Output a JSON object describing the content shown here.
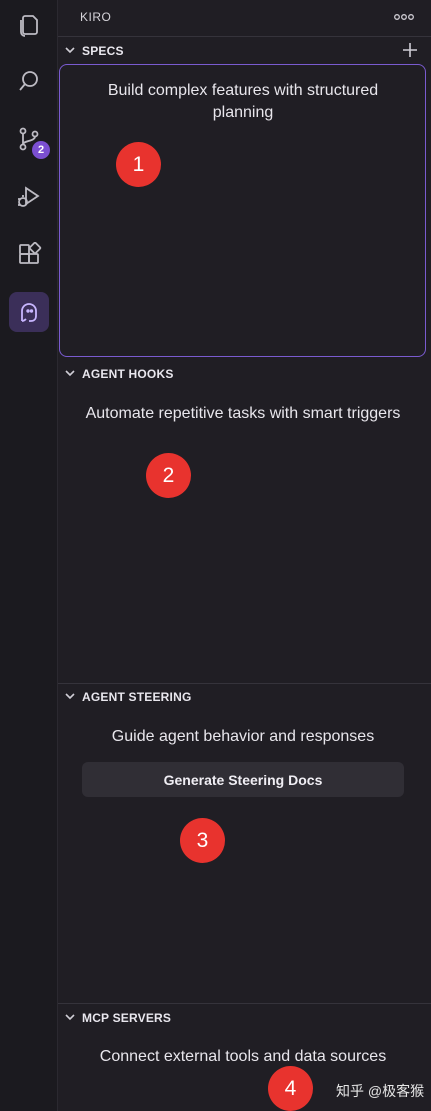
{
  "activity_bar": {
    "scm_badge": "2"
  },
  "panel": {
    "title": "KIRO"
  },
  "sections": {
    "specs": {
      "title": "SPECS",
      "description": "Build complex features with structured planning"
    },
    "agent_hooks": {
      "title": "AGENT HOOKS",
      "description": "Automate repetitive tasks with smart triggers"
    },
    "agent_steering": {
      "title": "AGENT STEERING",
      "description": "Guide agent behavior and responses",
      "button_label": "Generate Steering Docs"
    },
    "mcp_servers": {
      "title": "MCP SERVERS",
      "description": "Connect external tools and data sources"
    }
  },
  "annotations": [
    "1",
    "2",
    "3",
    "4"
  ],
  "watermark": "知乎 @极客猴",
  "colors": {
    "accent": "#7a5bd0",
    "badge": "#7b4fd1",
    "marker": "#e8332e"
  }
}
